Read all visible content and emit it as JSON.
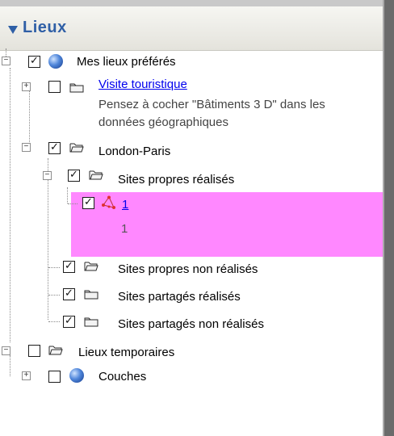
{
  "panel": {
    "title": "Lieux"
  },
  "tree": {
    "my_places": {
      "label": "Mes lieux préférés",
      "checked": true
    },
    "tourist_visit": {
      "label": "Visite touristique",
      "checked": false,
      "description_line1": "Pensez à cocher \"Bâtiments 3 D\" dans les",
      "description_line2": "données géographiques"
    },
    "london_paris": {
      "label": "London-Paris",
      "checked": true
    },
    "own_sites_done": {
      "label": "Sites propres réalisés",
      "checked": true
    },
    "path_item": {
      "label": "1",
      "subtext": "1",
      "checked": true
    },
    "own_sites_not_done": {
      "label": "Sites propres non réalisés",
      "checked": true
    },
    "shared_sites_done": {
      "label": "Sites partagés réalisés",
      "checked": true
    },
    "shared_sites_not_done": {
      "label": "Sites partagés non réalisés",
      "checked": true
    },
    "temporary_places": {
      "label": "Lieux temporaires",
      "checked": false
    },
    "layers": {
      "label": "Couches",
      "checked": false
    }
  },
  "colors": {
    "header_text": "#2f5fa6",
    "selection_bg": "#ff88ff",
    "link": "#0000ee"
  }
}
